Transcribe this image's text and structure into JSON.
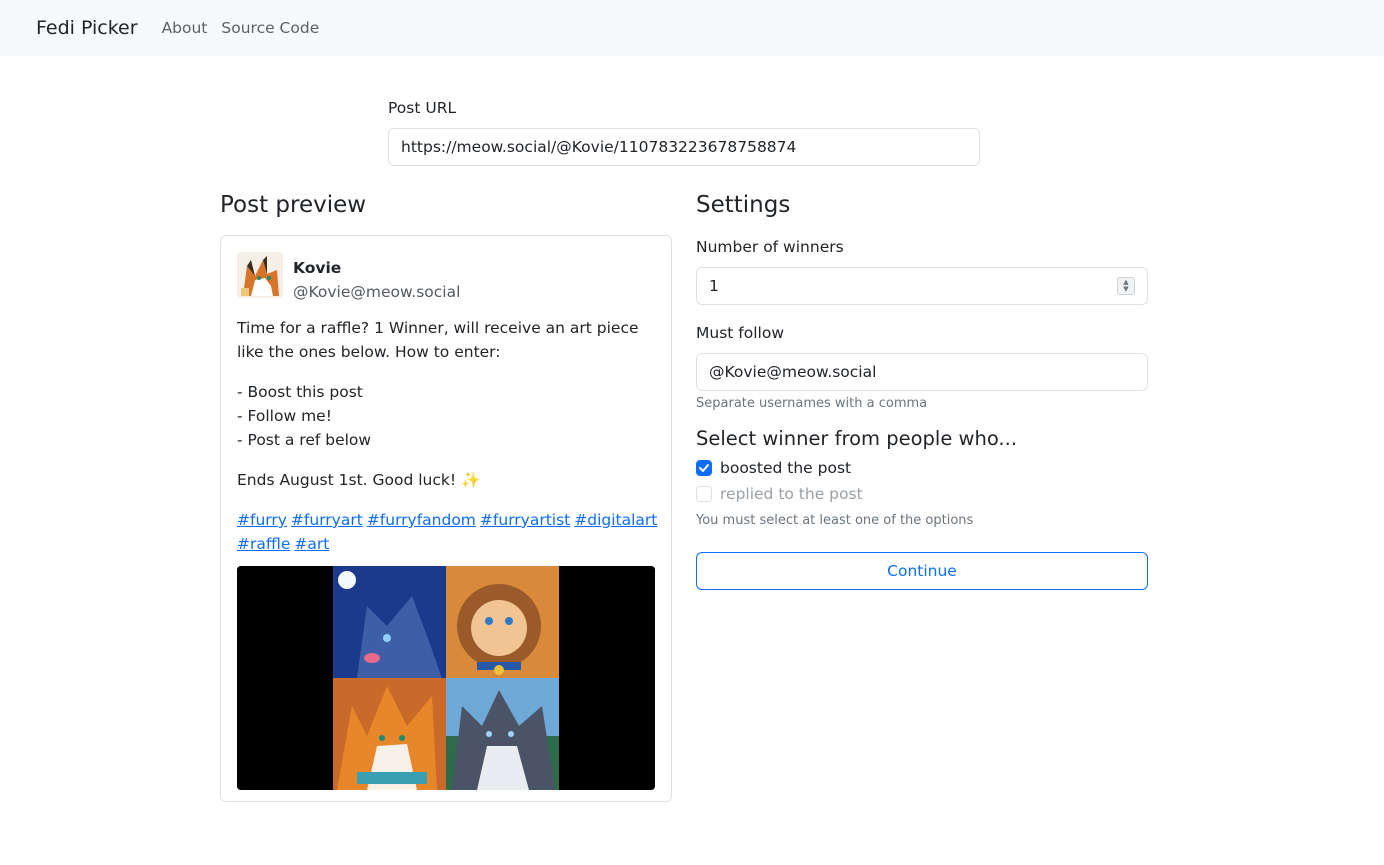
{
  "navbar": {
    "brand": "Fedi Picker",
    "links": [
      {
        "label": "About"
      },
      {
        "label": "Source Code"
      }
    ]
  },
  "post_url": {
    "label": "Post URL",
    "value": "https://meow.social/@Kovie/110783223678758874"
  },
  "preview": {
    "title": "Post preview",
    "author_name": "Kovie",
    "author_handle": "@Kovie@meow.social",
    "paragraph_1": "Time for a raffle? 1 Winner, will receive an art piece like the ones below. How to enter:",
    "list_1": "- Boost this post",
    "list_2": "- Follow me!",
    "list_3": "- Post a ref below",
    "paragraph_3": "Ends August 1st. Good luck! ✨",
    "tags": [
      "#furry",
      "#furryart",
      "#furryfandom",
      "#furryartist",
      "#digitalart",
      "#raffle",
      "#art"
    ]
  },
  "settings": {
    "title": "Settings",
    "winners_label": "Number of winners",
    "winners_value": "1",
    "must_follow_label": "Must follow",
    "must_follow_value": "@Kovie@meow.social",
    "must_follow_help": "Separate usernames with a comma",
    "select_heading": "Select winner from people who...",
    "option_boosted": "boosted the post",
    "option_boosted_checked": true,
    "option_replied": "replied to the post",
    "option_replied_checked": false,
    "options_help": "You must select at least one of the options",
    "continue_label": "Continue"
  },
  "colors": {
    "accent": "#0d6efd",
    "navbar_bg": "#f8f9fa"
  }
}
